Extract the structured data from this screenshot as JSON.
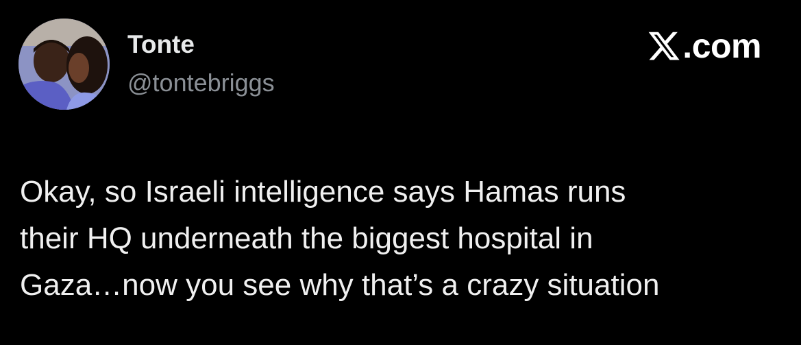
{
  "author": {
    "display_name": "Tonte",
    "handle": "@tontebriggs",
    "avatar_icon": "profile-photo"
  },
  "brand": {
    "icon": "x-logo-icon",
    "text": ".com"
  },
  "tweet": {
    "lines": [
      "Okay, so Israeli intelligence says Hamas runs",
      "their HQ underneath the biggest hospital in",
      "Gaza…now you see why that’s a crazy situation"
    ]
  },
  "colors": {
    "background": "#000000",
    "text": "#e7e9ea",
    "secondary_text": "#8b9096"
  }
}
